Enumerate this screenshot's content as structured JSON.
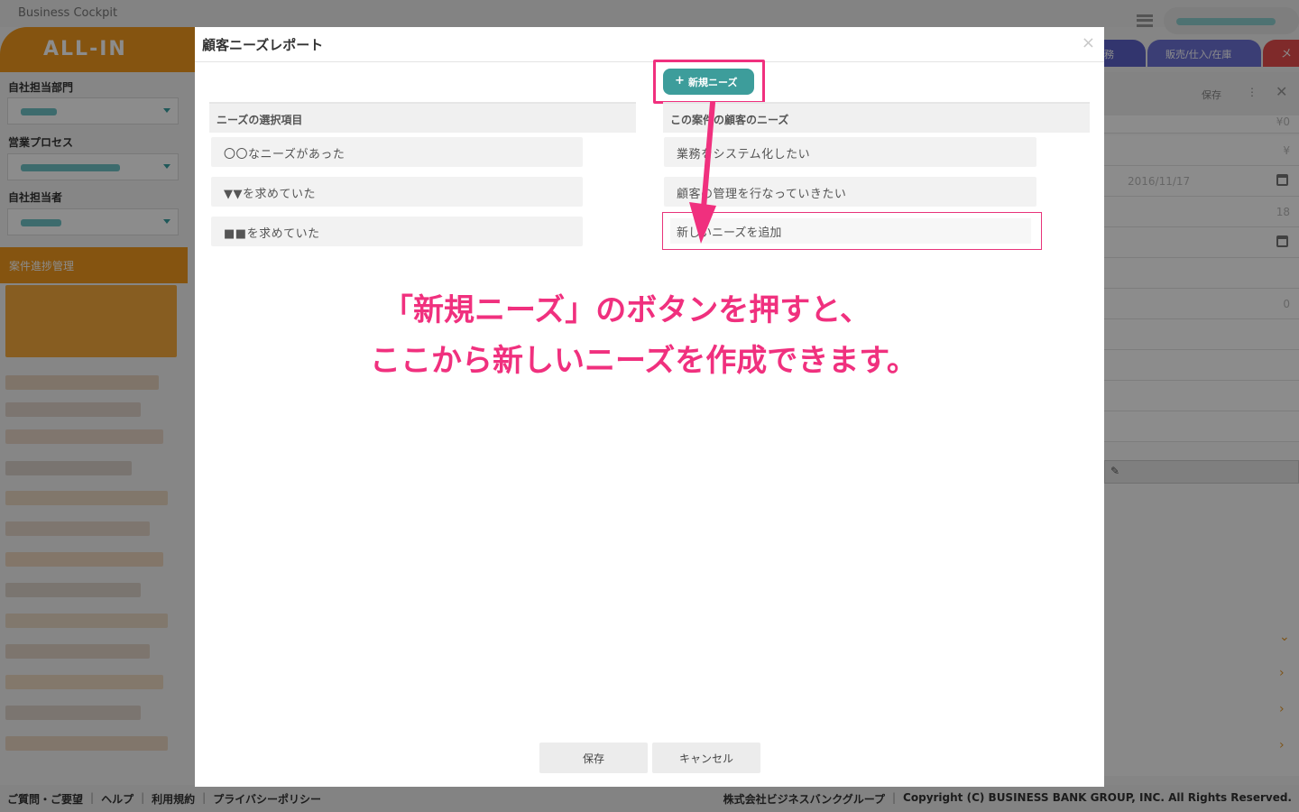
{
  "app": {
    "title": "Business Cockpit",
    "logo": "ALL-IN",
    "sidebar": {
      "fields": [
        {
          "label": "自社担当部門"
        },
        {
          "label": "営業プロセス"
        },
        {
          "label": "自社担当者"
        }
      ],
      "section": "案件進捗管理"
    },
    "tabs": {
      "partial": "務",
      "sales": "販売/仕入/在庫",
      "red": "メ"
    },
    "panel": {
      "save": "保存",
      "dots": "⋮",
      "close": "✕",
      "rows": [
        "¥0",
        "¥",
        "2016/11/17",
        "18",
        "",
        "0"
      ]
    },
    "footer": {
      "links": [
        "ご質問・ご要望",
        "ヘルプ",
        "利用規約",
        "プライバシーポリシー"
      ],
      "company": "株式会社ビジネスバンクグループ",
      "copyright": "Copyright (C) BUSINESS BANK GROUP, INC. All Rights Reserved."
    }
  },
  "modal": {
    "title": "顧客ニーズレポート",
    "close": "×",
    "new_button": {
      "icon": "+",
      "label": "新規ニーズ"
    },
    "left_column": {
      "header": "ニーズの選択項目",
      "items": [
        "〇〇なニーズがあった",
        "▼▼を求めていた",
        "■■を求めていた"
      ]
    },
    "right_column": {
      "header": "この案件の顧客のニーズ",
      "items": [
        "業務をシステム化したい",
        "顧客の管理を行なっていきたい"
      ],
      "new_item_value": "新しいニーズを追加"
    },
    "annotation": {
      "line1": "「新規ニーズ」のボタンを押すと、",
      "line2": "ここから新しいニーズを作成できます。",
      "color": "#f0307e"
    },
    "save_label": "保存",
    "cancel_label": "キャンセル"
  }
}
